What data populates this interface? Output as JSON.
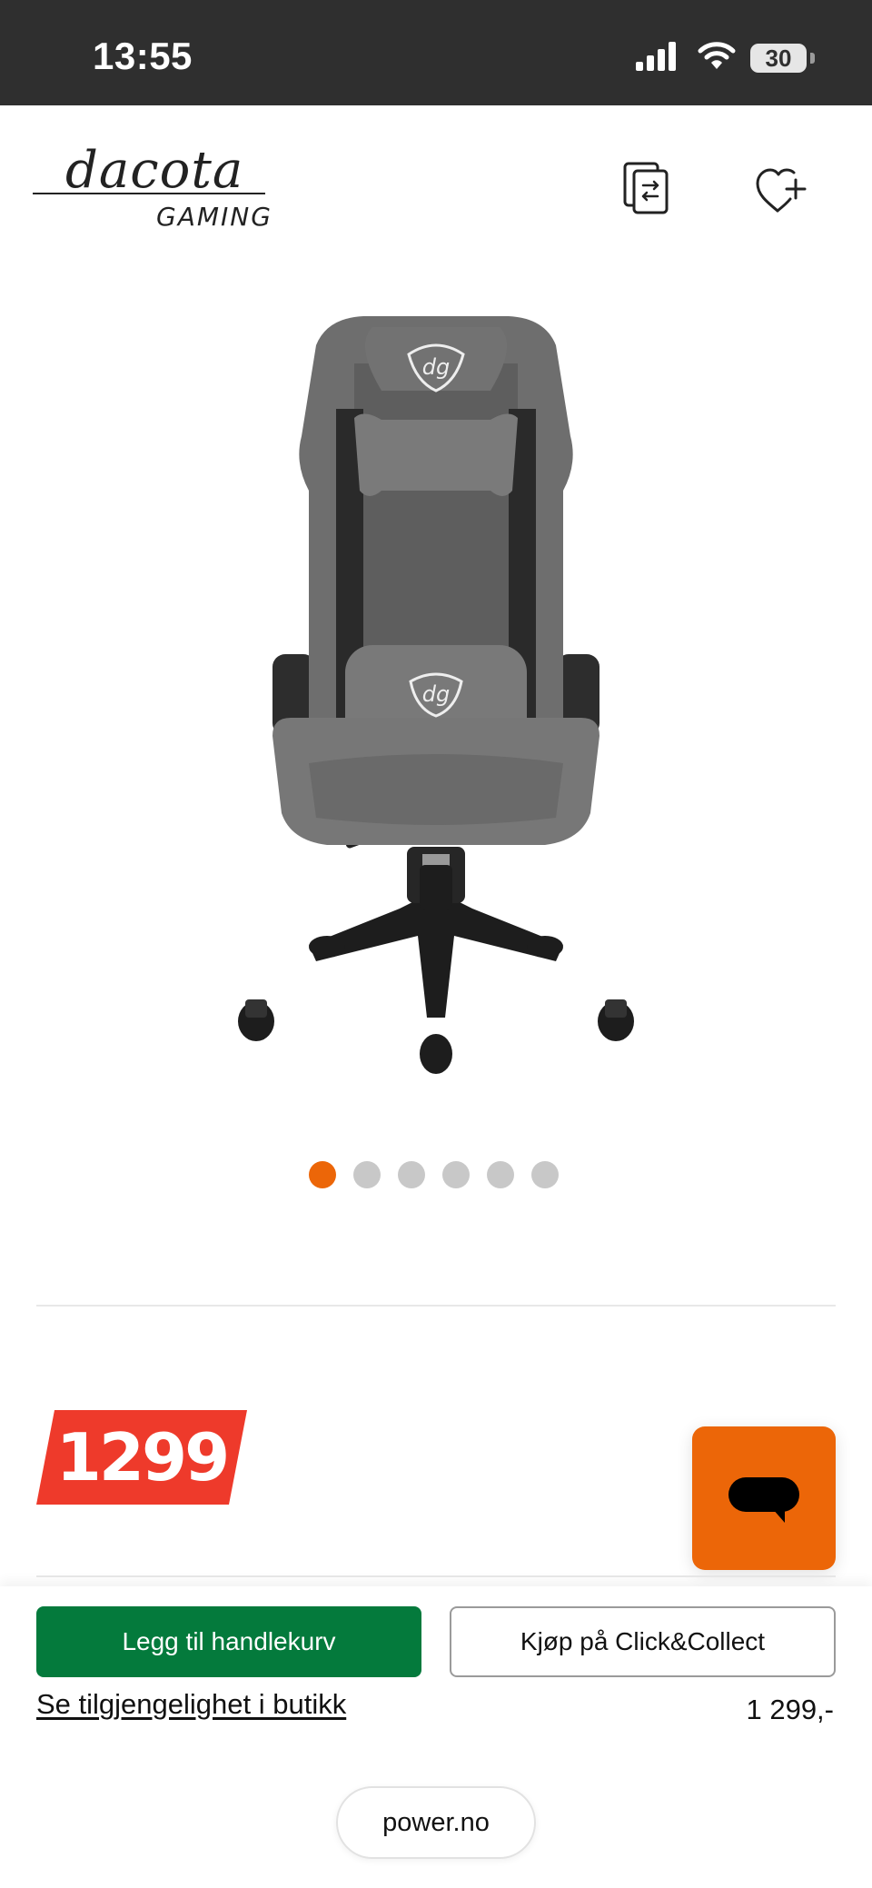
{
  "status_bar": {
    "time": "13:55",
    "battery": "30",
    "icons": [
      "signal-icon",
      "wifi-icon",
      "battery-icon"
    ]
  },
  "header": {
    "brand_script": "dacota",
    "brand_sub": "GAMING",
    "icons": [
      "compare-icon",
      "wishlist-heart-plus-icon"
    ]
  },
  "product": {
    "image_description_icon": "gaming-chair-image",
    "carousel": {
      "total": 6,
      "active_index": 0
    },
    "price_badge": "1299",
    "price": "1 299,-"
  },
  "actions": {
    "add_to_cart": "Legg til handlekurv",
    "click_collect": "Kjøp på Click&Collect",
    "availability_link": "Se tilgjengelighet i butikk"
  },
  "browser": {
    "url": "power.no"
  },
  "colors": {
    "accent_orange": "#ec6608",
    "cart_green": "#047a3c",
    "price_red": "#ee3a2b",
    "status_bar_bg": "#2f2f2f"
  }
}
